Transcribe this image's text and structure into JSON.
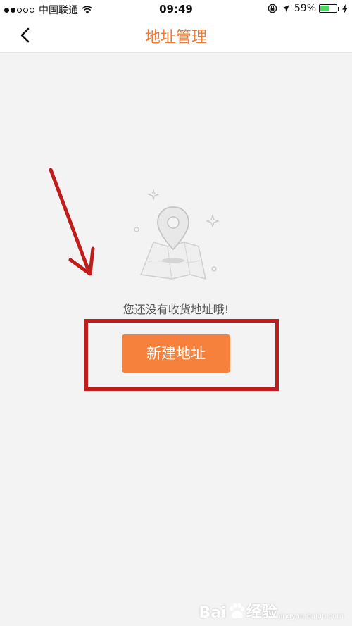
{
  "status_bar": {
    "carrier": "中国联通",
    "time": "09:49",
    "battery_percent": "59%",
    "battery_level": 0.59,
    "signal_bars_filled": 2,
    "signal_bars_total": 5,
    "battery_color": "#4cd964"
  },
  "nav": {
    "title": "地址管理",
    "back_icon": "chevron-left-icon",
    "title_color": "#ef7b35"
  },
  "empty_state": {
    "illustration_icon": "map-pin-icon",
    "message": "您还没有收货地址哦!",
    "button_label": "新建地址",
    "button_color": "#f5813d"
  },
  "annotation": {
    "color": "#c11b1b"
  },
  "watermark": {
    "text_left": "Bai",
    "text_right": "经验",
    "subtext": "jingyan.baidu.com"
  }
}
